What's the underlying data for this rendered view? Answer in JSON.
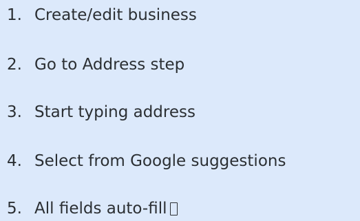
{
  "steps": [
    {
      "number": "1.",
      "text": "Create/edit business"
    },
    {
      "number": "2.",
      "text": "Go to Address step"
    },
    {
      "number": "3.",
      "text": "Start typing address"
    },
    {
      "number": "4.",
      "text": "Select from Google suggestions"
    },
    {
      "number": "5.",
      "text": "All fields auto-fill"
    }
  ],
  "trailing_glyph": "missing-glyph-box-icon"
}
